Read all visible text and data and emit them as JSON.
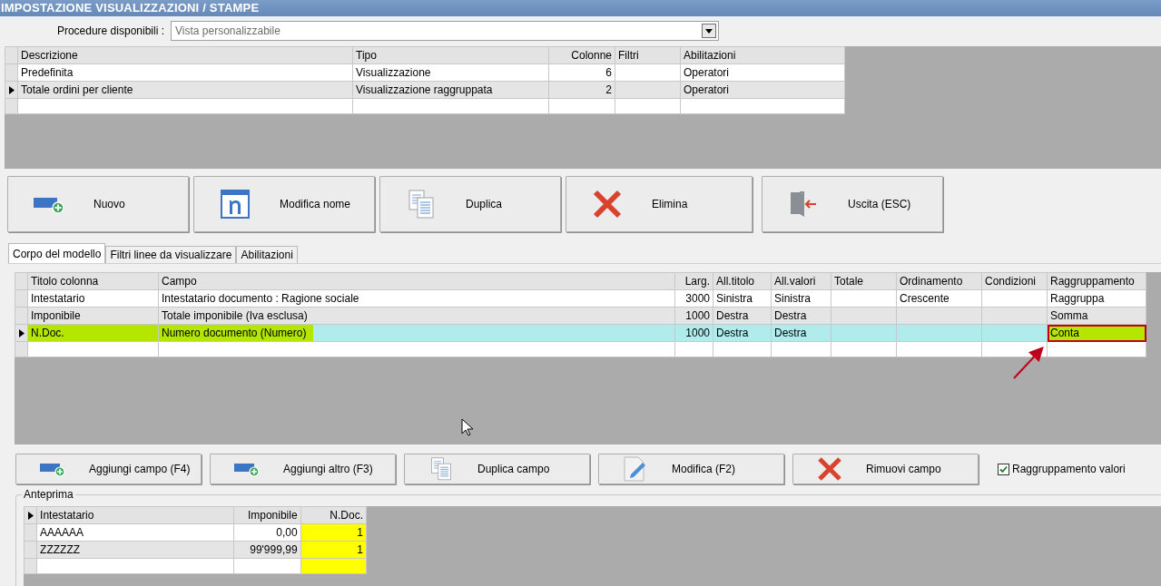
{
  "window": {
    "title": "IMPOSTAZIONE VISUALIZZAZIONI / STAMPE"
  },
  "procedure": {
    "label": "Procedure disponibili :",
    "value": "Vista personalizzabile"
  },
  "views": {
    "columns": [
      {
        "label": "Descrizione"
      },
      {
        "label": "Tipo"
      },
      {
        "label": "Colonne"
      },
      {
        "label": "Filtri"
      },
      {
        "label": "Abilitazioni"
      }
    ],
    "rows": [
      {
        "selected": false,
        "cells": [
          "Predefinita",
          "Visualizzazione",
          "6",
          null,
          "Operatori"
        ]
      },
      {
        "selected": true,
        "cells": [
          "Totale ordini per cliente",
          "Visualizzazione raggruppata",
          "2",
          null,
          "Operatori"
        ]
      }
    ]
  },
  "buttons": [
    {
      "kind": "add",
      "label": "Nuovo"
    },
    {
      "kind": "rename",
      "label": "Modifica nome"
    },
    {
      "kind": "copy",
      "label": "Duplica"
    },
    {
      "kind": "delete",
      "label": "Elimina"
    },
    {
      "kind": "exit",
      "label": "Uscita (ESC)"
    }
  ],
  "tabs": [
    {
      "label": "Corpo del modello",
      "selected": true
    },
    {
      "label": "Filtri linee da visualizzare",
      "selected": false
    },
    {
      "label": "Abilitazioni",
      "selected": false
    }
  ],
  "fields": {
    "columns": [
      {
        "label": "Titolo colonna"
      },
      {
        "label": "Campo"
      },
      {
        "label": "Larg."
      },
      {
        "label": "All.titolo"
      },
      {
        "label": "All.valori"
      },
      {
        "label": "Totale"
      },
      {
        "label": "Ordinamento"
      },
      {
        "label": "Condizioni"
      },
      {
        "label": "Raggruppamento"
      }
    ],
    "rows": [
      {
        "selected": false,
        "highlighted": false,
        "marked": false,
        "cells": [
          "Intestatario",
          "Intestatario documento : Ragione sociale",
          "3000",
          "Sinistra",
          "Sinistra",
          null,
          "Crescente",
          null,
          "Raggruppa"
        ]
      },
      {
        "selected": false,
        "highlighted": false,
        "marked": false,
        "cells": [
          "Imponibile",
          "Totale imponibile (Iva esclusa)",
          "1000",
          "Destra",
          "Destra",
          null,
          null,
          null,
          "Somma"
        ]
      },
      {
        "selected": true,
        "highlighted": true,
        "marked": true,
        "cells": [
          "N.Doc.",
          "Numero documento (Numero)",
          "1000",
          "Destra",
          "Destra",
          null,
          null,
          null,
          "Conta"
        ]
      }
    ]
  },
  "field_buttons": [
    {
      "kind": "add",
      "label": "Aggiungi campo (F4)"
    },
    {
      "kind": "add",
      "label": "Aggiungi altro (F3)"
    },
    {
      "kind": "copy",
      "label": "Duplica campo"
    },
    {
      "kind": "edit",
      "label": "Modifica (F2)"
    },
    {
      "kind": "delete",
      "label": "Rimuovi campo"
    }
  ],
  "grouping_checkbox": {
    "label": "Raggruppamento valori",
    "checked": true
  },
  "preview": {
    "title": "Anteprima",
    "pointer": true,
    "columns": [
      {
        "label": "Intestatario",
        "highlighted": false
      },
      {
        "label": "Imponibile",
        "highlighted": false
      },
      {
        "label": "N.Doc.",
        "highlighted": true
      }
    ],
    "rows": [
      {
        "cells": [
          "AAAAAA",
          "0,00",
          "1"
        ]
      },
      {
        "cells": [
          "ZZZZZZ",
          "99'999,99",
          "1"
        ]
      }
    ]
  }
}
